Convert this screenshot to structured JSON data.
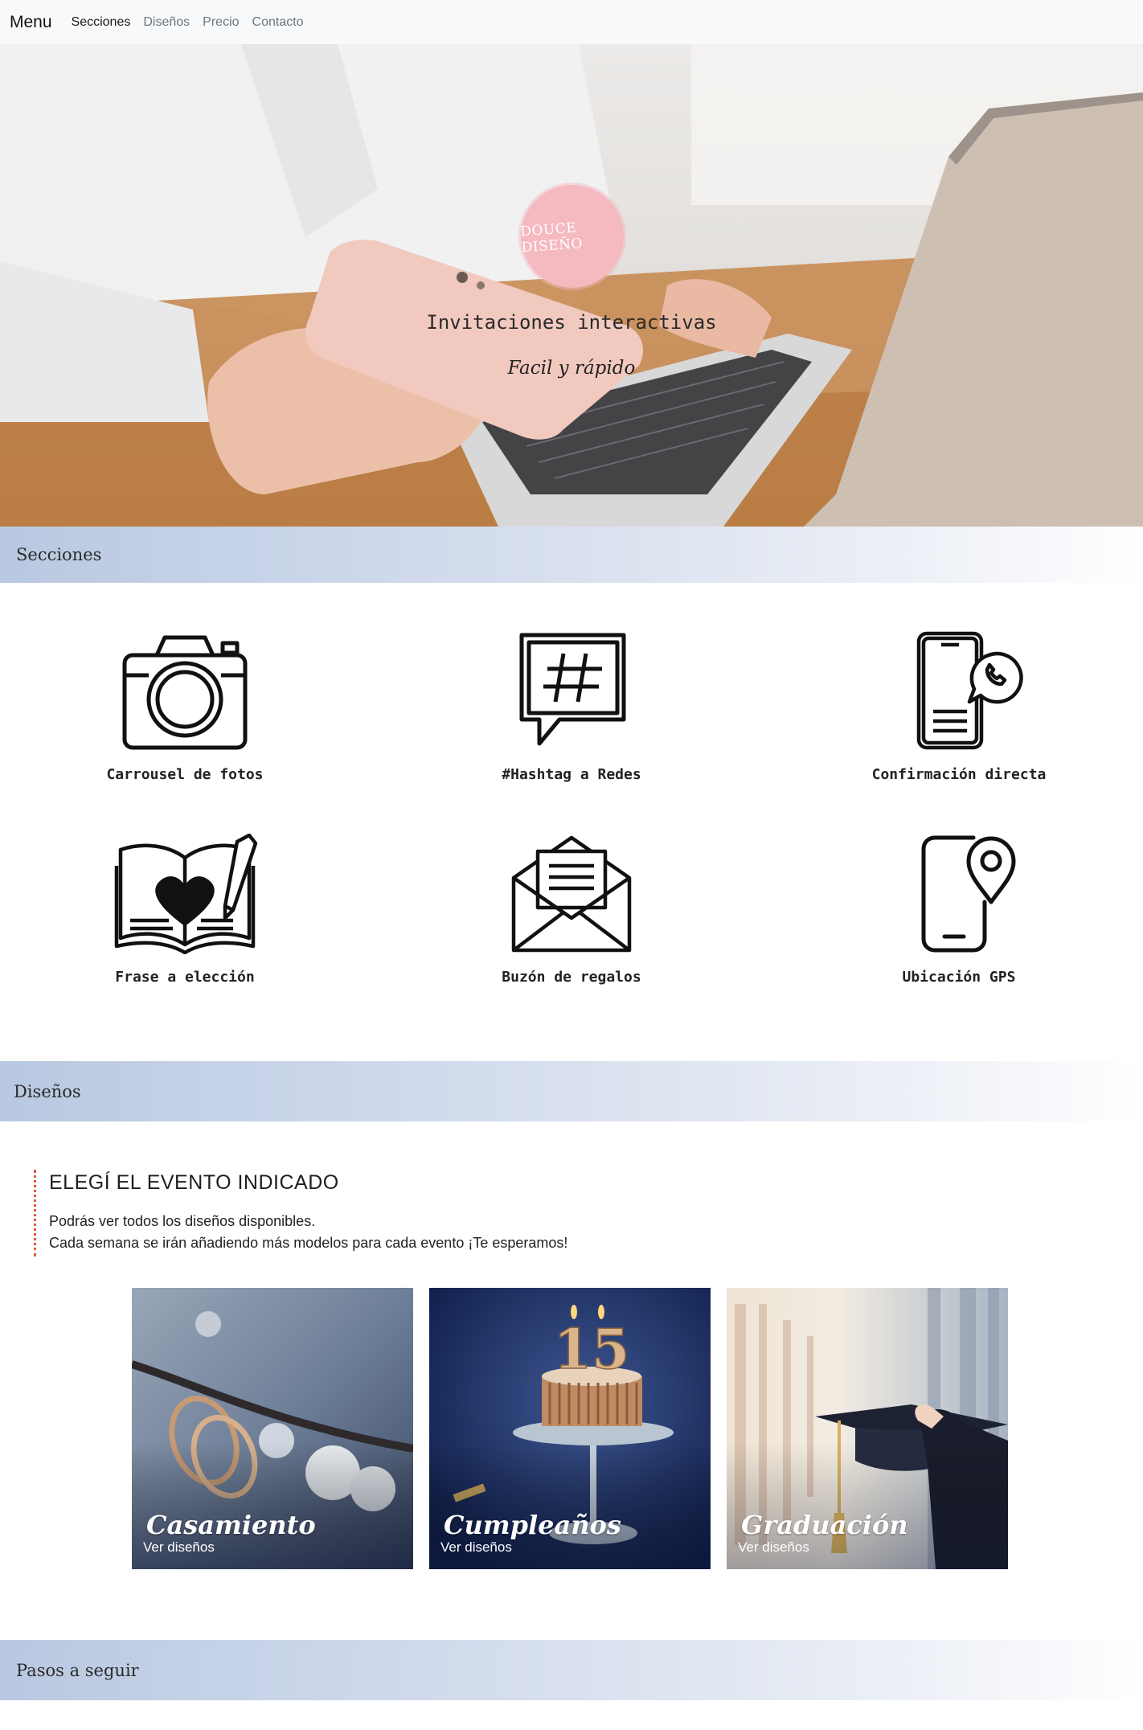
{
  "nav": {
    "brand": "Menu",
    "links": [
      {
        "label": "Secciones",
        "active": true
      },
      {
        "label": "Diseños",
        "active": false
      },
      {
        "label": "Precio",
        "active": false
      },
      {
        "label": "Contacto",
        "active": false
      }
    ]
  },
  "hero": {
    "logo_text": "DOUCE DISEÑO",
    "title": "Invitaciones interactivas",
    "subtitle": "Facil y rápido"
  },
  "sections": {
    "secciones": "Secciones",
    "disenos": "Diseños",
    "pasos": "Pasos a seguir"
  },
  "features": [
    {
      "label": "Carrousel de fotos",
      "icon": "camera-icon"
    },
    {
      "label": "#Hashtag a Redes",
      "icon": "hashtag-icon"
    },
    {
      "label": "Confirmación directa",
      "icon": "phone-confirm-icon"
    },
    {
      "label": "Frase a elección",
      "icon": "book-heart-icon"
    },
    {
      "label": "Buzón de regalos",
      "icon": "envelope-icon"
    },
    {
      "label": "Ubicación GPS",
      "icon": "gps-phone-icon"
    }
  ],
  "designs": {
    "heading": "ELEGÍ EL EVENTO INDICADO",
    "line1": "Podrás ver todos los diseños disponibles.",
    "line2": "Cada semana se irán añadiendo más modelos para cada evento ¡Te esperamos!",
    "cards": [
      {
        "title": "Casamiento",
        "link": "Ver diseños"
      },
      {
        "title": "Cumpleaños",
        "link": "Ver diseños"
      },
      {
        "title": "Graduación",
        "link": "Ver diseños"
      }
    ],
    "cake_number": "15"
  },
  "colors": {
    "band_start": "#b9c8e1",
    "accent_border": "#e05a3c",
    "logo_pink": "#f5b9c0"
  }
}
